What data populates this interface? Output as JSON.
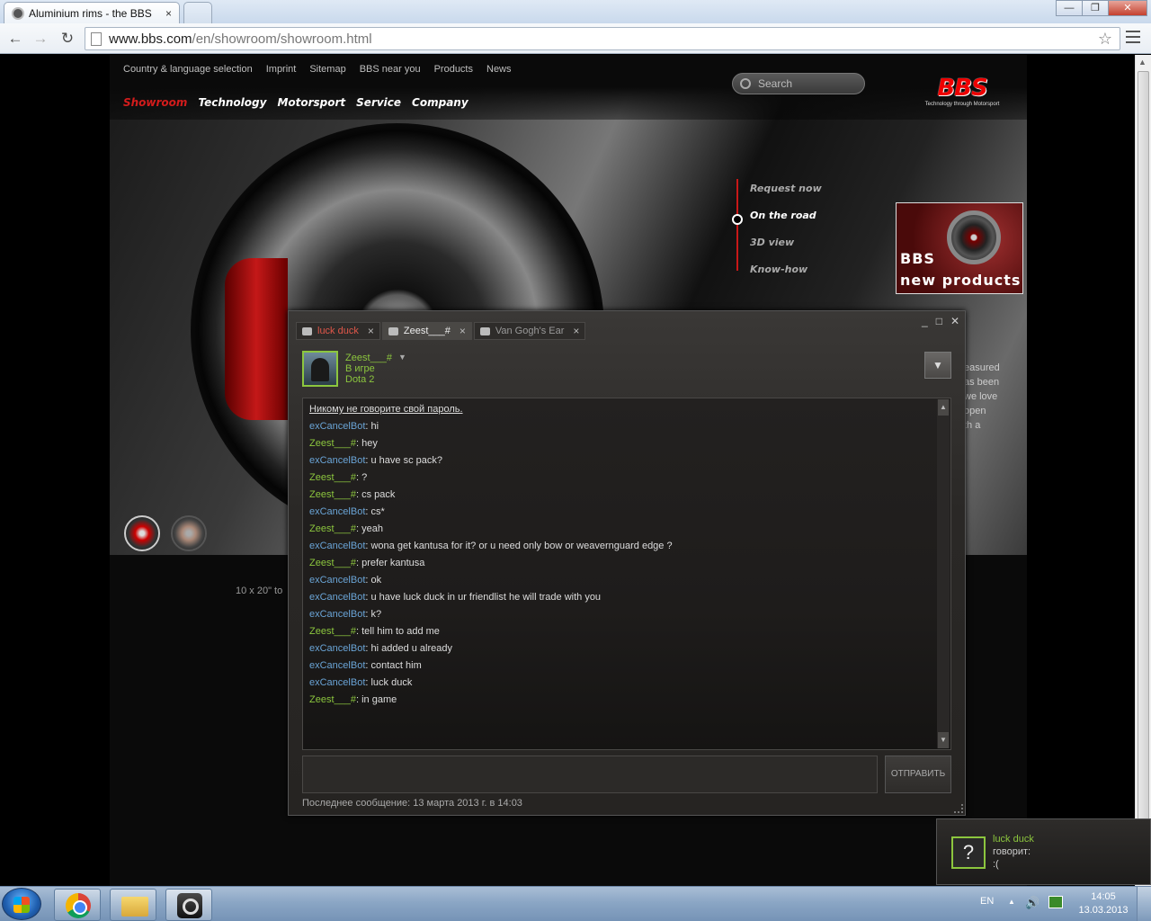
{
  "browser": {
    "tab_title": "Aluminium rims - the BBS",
    "tab_close": "×",
    "url_domain": "www.bbs.com",
    "url_path": "/en/showroom/showroom.html",
    "star": "☆",
    "back": "←",
    "forward": "→",
    "reload": "↻",
    "minimize": "—",
    "maximize": "❐",
    "close": "✕"
  },
  "site": {
    "topnav": [
      "Country & language selection",
      "Imprint",
      "Sitemap",
      "BBS near you",
      "Products",
      "News"
    ],
    "search_placeholder": "Search",
    "logo": "BBS",
    "logo_tagline": "Technology through Motorsport",
    "mainnav": [
      "Showroom",
      "Technology",
      "Motorsport",
      "Service",
      "Company"
    ],
    "sidemenu": [
      "Request now",
      "On the road",
      "3D view",
      "Know-how"
    ],
    "promo_line1": "BBS",
    "promo_line2": "new products",
    "right_text": [
      "easured",
      "as been",
      "we love",
      "open",
      "th a"
    ],
    "size_text": "10 x 20\" to"
  },
  "chat": {
    "tabs": [
      {
        "label": "luck duck"
      },
      {
        "label": "Zeest___#"
      },
      {
        "label": "Van Gogh's Ear"
      }
    ],
    "tab_close": "×",
    "window_buttons": [
      "_",
      "□",
      "✕"
    ],
    "friend": {
      "name": "Zeest___#",
      "dropdown": "▼",
      "status": "В игре",
      "game": "Dota 2"
    },
    "options": "▼",
    "warning": "Никому не говорите свой пароль.",
    "messages": [
      {
        "who": "exCancelBot",
        "text": ": hi"
      },
      {
        "who": "Zeest___#",
        "text": ": hey"
      },
      {
        "who": "exCancelBot",
        "text": ": u have sc pack?"
      },
      {
        "who": "Zeest___#",
        "text": ": ?"
      },
      {
        "who": "Zeest___#",
        "text": ": cs pack"
      },
      {
        "who": "exCancelBot",
        "text": ": cs*"
      },
      {
        "who": "Zeest___#",
        "text": ": yeah"
      },
      {
        "who": "exCancelBot",
        "text": ": wona get kantusa for it? or u need only bow or weavernguard edge ?"
      },
      {
        "who": "Zeest___#",
        "text": ": prefer kantusa"
      },
      {
        "who": "exCancelBot",
        "text": ": ok"
      },
      {
        "who": "exCancelBot",
        "text": ": u have luck duck in ur friendlist he will trade with you"
      },
      {
        "who": "exCancelBot",
        "text": ": k?"
      },
      {
        "who": "Zeest___#",
        "text": ": tell him to add me"
      },
      {
        "who": "exCancelBot",
        "text": ": hi added u already"
      },
      {
        "who": "exCancelBot",
        "text": ": contact him"
      },
      {
        "who": "exCancelBot",
        "text": ": luck duck"
      },
      {
        "who": "Zeest___#",
        "text": ": in game"
      }
    ],
    "send_label": "ОТПРАВИТЬ",
    "last_message": "Последнее сообщение: 13 марта 2013 г. в 14:03"
  },
  "notification": {
    "avatar": "?",
    "name": "luck duck",
    "says": "говорит:",
    "text": ":("
  },
  "taskbar": {
    "language": "EN",
    "time": "14:05",
    "date": "13.03.2013"
  },
  "colors": {
    "accent_red": "#d31c1c",
    "steam_green": "#8cc63e",
    "steam_blue": "#6aa4d6"
  }
}
